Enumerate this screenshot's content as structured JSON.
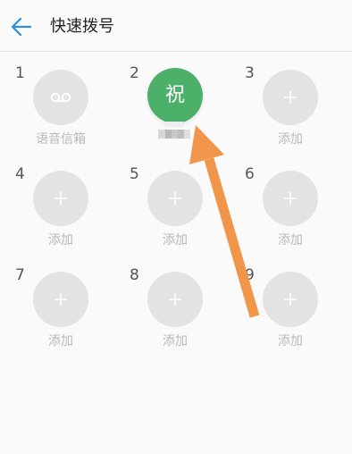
{
  "header": {
    "title": "快速拨号",
    "back_icon": "arrow-left-icon",
    "accent_color": "#2f8ee0"
  },
  "speed_dial": {
    "slots": [
      {
        "number": "1",
        "label": "语音信箱",
        "icon": "voicemail-icon"
      },
      {
        "number": "2",
        "contact_initial": "祝",
        "contact_color": "#4caf6a"
      },
      {
        "number": "3",
        "label": "添加",
        "icon": "plus-icon"
      },
      {
        "number": "4",
        "label": "添加",
        "icon": "plus-icon"
      },
      {
        "number": "5",
        "label": "添加",
        "icon": "plus-icon"
      },
      {
        "number": "6",
        "label": "添加",
        "icon": "plus-icon"
      },
      {
        "number": "7",
        "label": "添加",
        "icon": "plus-icon"
      },
      {
        "number": "8",
        "label": "添加",
        "icon": "plus-icon"
      },
      {
        "number": "9",
        "label": "添加",
        "icon": "plus-icon"
      }
    ]
  },
  "annotation": {
    "arrow_color": "#f0954a",
    "icon": "pointer-arrow-icon"
  }
}
